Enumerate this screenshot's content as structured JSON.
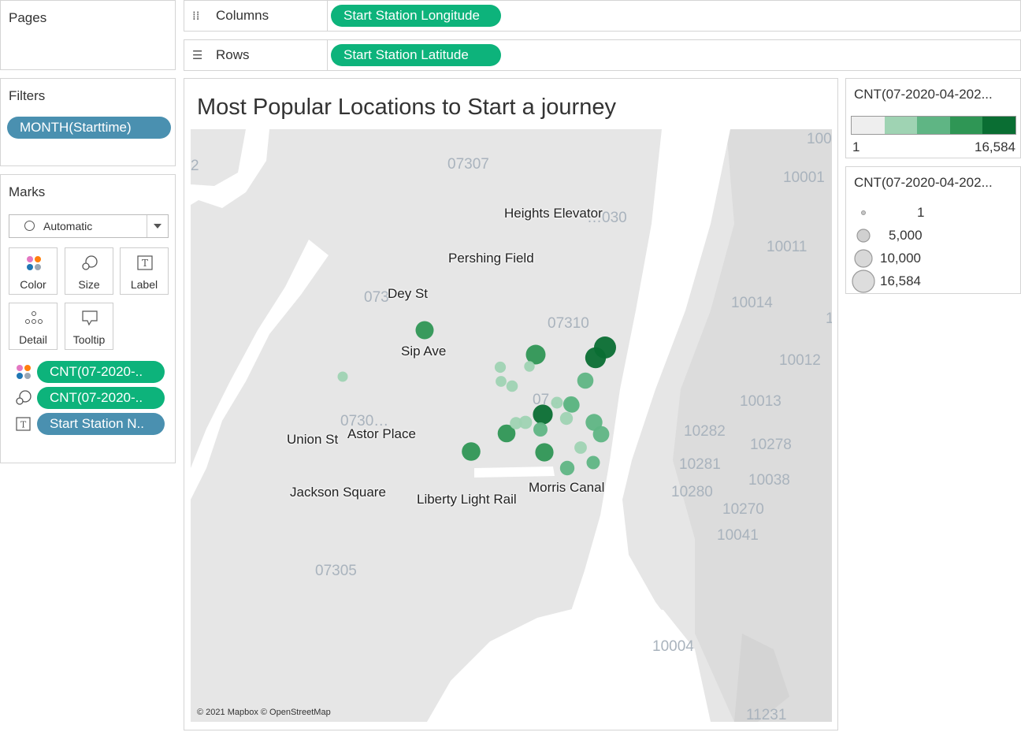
{
  "pages": {
    "title": "Pages"
  },
  "filters": {
    "title": "Filters",
    "pill": "MONTH(Starttime)"
  },
  "marks": {
    "title": "Marks",
    "mark_type": "Automatic",
    "buttons": {
      "color": "Color",
      "size": "Size",
      "label": "Label",
      "detail": "Detail",
      "tooltip": "Tooltip"
    },
    "fields": {
      "color_field": "CNT(07-2020-..",
      "size_field": "CNT(07-2020-..",
      "label_field": "Start Station N.."
    }
  },
  "shelves": {
    "columns_label": "Columns",
    "columns_pill": "Start Station Longitude",
    "rows_label": "Rows",
    "rows_pill": "Start Station Latitude"
  },
  "view": {
    "title": "Most Popular Locations to Start  a journey",
    "attribution": "© 2021 Mapbox © OpenStreetMap"
  },
  "map": {
    "station_labels": [
      "Heights Elevator",
      "Pershing Field",
      "Dey St",
      "Sip Ave",
      "Union St",
      "Astor Place",
      "Jackson Square",
      "Liberty Light Rail",
      "Morris Canal"
    ],
    "zip_labels": [
      "07307",
      "10001",
      "10011",
      "10014",
      "07310",
      "10012",
      "10013",
      "10282",
      "10278",
      "10281",
      "10038",
      "10280",
      "10270",
      "10041",
      "07305",
      "10004",
      "11231",
      "100",
      "2",
      "073",
      "0730…",
      "07…",
      "…030",
      "1"
    ],
    "marker_counts": [
      16584,
      14200,
      12600,
      12400,
      10500,
      10200,
      9800,
      9400,
      8200,
      7600,
      7300,
      6900,
      6200,
      5200,
      4900,
      4200,
      4000,
      3700,
      3300,
      3100,
      2800,
      2500,
      2300,
      2100,
      1900,
      1700
    ]
  },
  "color_legend": {
    "title": "CNT(07-2020-04-202...",
    "min_label": "1",
    "max_label": "16,584",
    "colors": [
      "#eeeeee",
      "#9fd3b3",
      "#5fb584",
      "#2f9655",
      "#0a6e33"
    ]
  },
  "size_legend": {
    "title": "CNT(07-2020-04-202...",
    "items": [
      "1",
      "5,000",
      "10,000",
      "16,584"
    ]
  }
}
